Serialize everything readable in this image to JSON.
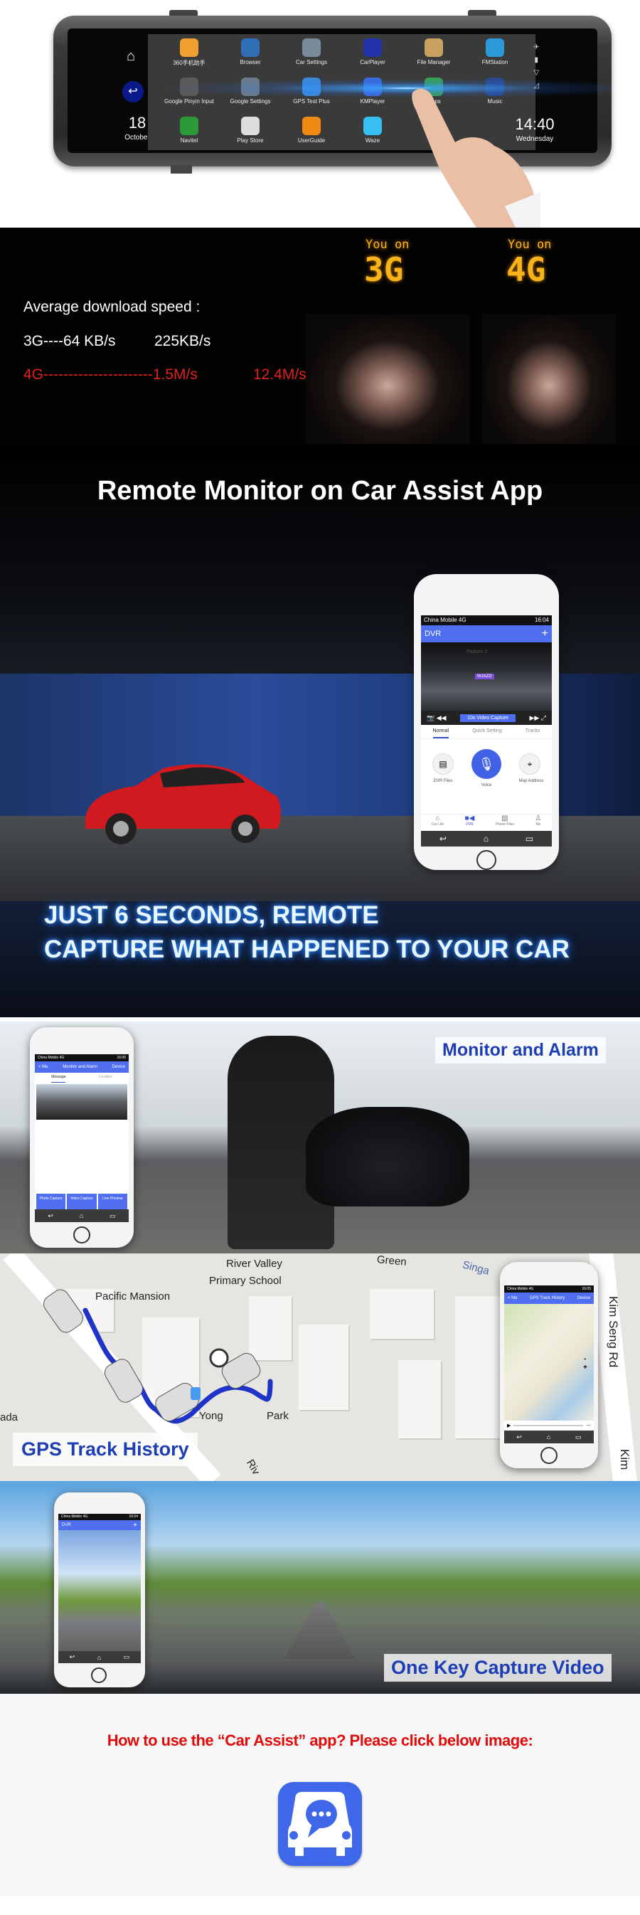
{
  "mirror": {
    "apps": [
      {
        "label": "360手机助手",
        "color": "#f0a030"
      },
      {
        "label": "Browser",
        "color": "#2f6fb8"
      },
      {
        "label": "Car Settings",
        "color": "#7a8a99"
      },
      {
        "label": "CarPlayer",
        "color": "#2233aa"
      },
      {
        "label": "File Manager",
        "color": "#c8a060"
      },
      {
        "label": "FMStation",
        "color": "#2a9ad8"
      },
      {
        "label": "Google Pinyin Input",
        "color": "#5a5a5a"
      },
      {
        "label": "Google Settings",
        "color": "#6a7a88"
      },
      {
        "label": "GPS Test Plus",
        "color": "#3a8ad8"
      },
      {
        "label": "KMPlayer",
        "color": "#3a6ad8"
      },
      {
        "label": "Maps",
        "color": "#3aa050"
      },
      {
        "label": "Music",
        "color": "#2a4a8a"
      },
      {
        "label": "Navitel",
        "color": "#2a9a3a"
      },
      {
        "label": "Play Store",
        "color": "#dddddd"
      },
      {
        "label": "UserGuide",
        "color": "#f08a10"
      },
      {
        "label": "Waze",
        "color": "#35c0f0"
      }
    ],
    "date_day": "18",
    "date_month": "October",
    "time": "14:40",
    "weekday": "Wednesday"
  },
  "speed": {
    "heading": "Average download speed :",
    "row3g_label": "3G----64 KB/s",
    "row3g_value": "225KB/s",
    "row4g_label": "4G----------------------1.5M/s",
    "row4g_value": "12.4M/s",
    "you_on": "You on",
    "g3": "3G",
    "g4": "4G",
    "accent_red": "#e0221b",
    "accent_gold": "#f7b41a"
  },
  "remote": {
    "title": "Remote Monitor on Car Assist App",
    "line1": "JUST 6 SECONDS, REMOTE",
    "line2": "CAPTURE WHAT HAPPENED TO YOUR CAR",
    "phone": {
      "status_carrier": "China Mobile 4G",
      "status_time": "16:04",
      "app_title": "DVR",
      "add": "+",
      "banner": "Poziom 2",
      "sign": "WJAZD",
      "capture_btn": "10s Video Capture",
      "tabs": [
        "Normal",
        "Quick Setting",
        "Tracks"
      ],
      "actions": [
        "DVR Files",
        "Voice",
        "Map Address"
      ],
      "bottom_nav": [
        "Car Life",
        "DVR",
        "Phone Files",
        "Me"
      ]
    }
  },
  "monitor": {
    "caption": "Monitor and Alarm",
    "phone": {
      "status_carrier": "China Mobile 4G",
      "status_time": "16:06",
      "back": "< Me",
      "title": "Monitor and Alarm",
      "right": "Device",
      "tabs": [
        "Message",
        "Location"
      ],
      "buttons": [
        "Photo Capture",
        "Video Capture",
        "Live Preview"
      ]
    }
  },
  "gps": {
    "caption": "GPS Track History",
    "map_labels": [
      "River Valley",
      "Primary School",
      "Pacific Mansion",
      "Green",
      "Singa",
      "ada",
      "Yong",
      "Park",
      "Riv",
      "Kim Seng Rd",
      "Kim"
    ],
    "track_color": "#1f33c8",
    "phone": {
      "status_carrier": "China Mobile 4G",
      "status_time": "16:05",
      "back": "< Me",
      "title": "GPS Track History",
      "right": "Device",
      "zoom_out": "-",
      "zoom_in": "+"
    }
  },
  "capture": {
    "caption": "One Key Capture Video",
    "phone": {
      "status_carrier": "China Mobile 4G",
      "status_time": "16:04",
      "app_title": "DVR",
      "add": "+"
    }
  },
  "howto": {
    "text": "How to use the  “Car Assist” app? Please click below image:",
    "icon": "car-assist-app-icon",
    "brand_color": "#3f67ea"
  }
}
